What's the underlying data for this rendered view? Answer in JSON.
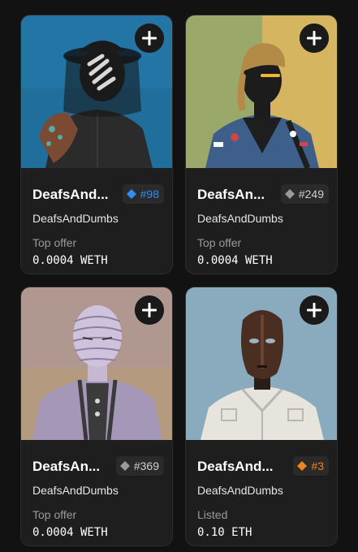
{
  "colors": {
    "background": "#121212",
    "card": "#1e1e1e",
    "rank_blue": "#2f8ff0",
    "rank_gray": "#9a9a9a",
    "rank_orange": "#f0841e"
  },
  "cards": [
    {
      "name": "DeafsAndDumbs",
      "name_display": "DeafsAnd...",
      "collection": "DeafsAndDumbs",
      "rank": "#98",
      "rank_tier": "blue",
      "price_label": "Top offer",
      "price": "0.0004 WETH",
      "add_icon": "plus-icon",
      "rank_icon": "diamond-icon"
    },
    {
      "name": "DeafsAndDumbs",
      "name_display": "DeafsAn...",
      "collection": "DeafsAndDumbs",
      "rank": "#249",
      "rank_tier": "gray",
      "price_label": "Top offer",
      "price": "0.0004 WETH",
      "add_icon": "plus-icon",
      "rank_icon": "diamond-icon"
    },
    {
      "name": "DeafsAndDumbs",
      "name_display": "DeafsAn...",
      "collection": "DeafsAndDumbs",
      "rank": "#369",
      "rank_tier": "gray",
      "price_label": "Top offer",
      "price": "0.0004 WETH",
      "add_icon": "plus-icon",
      "rank_icon": "diamond-icon"
    },
    {
      "name": "DeafsAndDumbs",
      "name_display": "DeafsAnd...",
      "collection": "DeafsAndDumbs",
      "rank": "#3",
      "rank_tier": "orange",
      "price_label": "Listed",
      "price": "0.10 ETH",
      "add_icon": "plus-icon",
      "rank_icon": "diamond-icon"
    }
  ]
}
